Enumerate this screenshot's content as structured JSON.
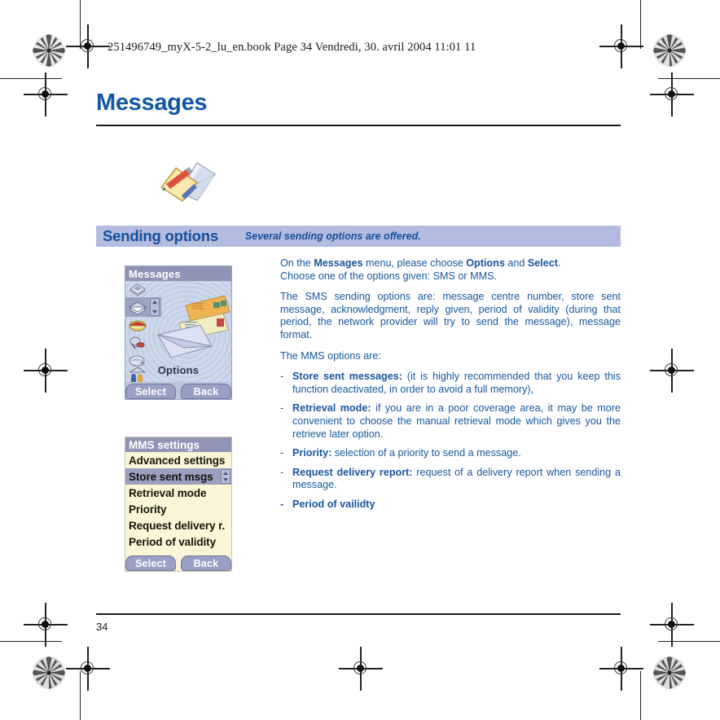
{
  "print_marks": {
    "book_header": "251496749_myX-5-2_lu_en.book  Page 34  Vendredi, 30. avril 2004  11:01 11"
  },
  "page": {
    "title": "Messages",
    "number": "34",
    "chapter_icon": "message-compose-icon"
  },
  "section": {
    "title": "Sending options",
    "subtitle": "Several sending options are offered."
  },
  "body": {
    "intro_line1_a": "On the ",
    "intro_line1_b": "Messages",
    "intro_line1_c": " menu, please choose ",
    "intro_line1_d": "Options",
    "intro_line1_e": " and ",
    "intro_line1_f": "Select",
    "intro_line1_g": ".",
    "intro_line2": "Choose one of the options given: SMS or MMS.",
    "sms_paragraph": "The SMS sending options are: message centre number, store sent message, acknowledgment, reply given, period of validity (during that period, the network provider will try to send the message), message format.",
    "mms_heading": "The MMS options are:",
    "mms_options": [
      {
        "dash": "-",
        "term": "Store sent messages:",
        "desc": " (it is highly recommended that you keep this function deactivated, in order to avoid a full memory),"
      },
      {
        "dash": "-",
        "term": "Retrieval mode:",
        "desc": " if you are in a poor coverage area, it may be more convenient to choose the manual retrieval mode which gives you the retrieve later option."
      },
      {
        "dash": "-",
        "term": "Priority:",
        "desc": " selection of a priority to send a message."
      },
      {
        "dash": "-",
        "term": "Request delivery report:",
        "desc": " request of a delivery report when sending a message."
      },
      {
        "dash": "-",
        "term": "Period of vailidty",
        "desc": ""
      }
    ]
  },
  "screenshot_messages": {
    "title": "Messages",
    "center_label": "Options",
    "softkey_left": "Select",
    "softkey_right": "Back",
    "icons": [
      "message-inbox-icon",
      "message-envelope-stack-icon",
      "message-template-icon",
      "message-voicemail-icon",
      "message-draft-icon",
      "message-broadcast-icon"
    ]
  },
  "screenshot_mms_settings": {
    "title": "MMS settings",
    "rows": [
      {
        "label": "Advanced settings",
        "selected": false
      },
      {
        "label": "Store sent msgs",
        "selected": true
      },
      {
        "label": "Retrieval mode",
        "selected": false
      },
      {
        "label": "Priority",
        "selected": false
      },
      {
        "label": "Request delivery r.",
        "selected": false
      },
      {
        "label": "Period of validity",
        "selected": false
      }
    ],
    "softkey_left": "Select",
    "softkey_right": "Back"
  },
  "colors": {
    "heading_blue": "#1257a5",
    "body_blue": "#15569f",
    "banner_bg": "#b3bbe0",
    "phone_title_bar": "#9194b6",
    "mms_screen_bg": "#fbf6d8"
  }
}
